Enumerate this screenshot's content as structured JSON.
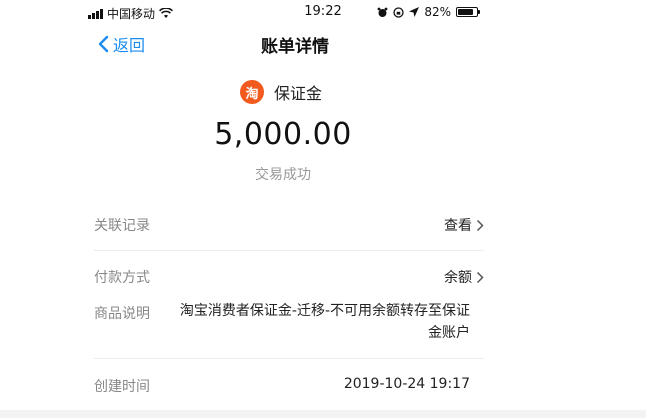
{
  "status_bar": {
    "carrier": "中国移动",
    "time": "19:22",
    "battery_percent": "82%",
    "battery_level": 0.82
  },
  "nav": {
    "back_label": "返回",
    "title": "账单详情"
  },
  "merchant": {
    "logo_char": "淘",
    "name": "保证金",
    "brand_color": "#f25a1e"
  },
  "transaction": {
    "amount": "5,000.00",
    "status": "交易成功"
  },
  "details": {
    "related": {
      "label": "关联记录",
      "value": "查看"
    },
    "payment": {
      "label": "付款方式",
      "value": "余额"
    },
    "description": {
      "label": "商品说明",
      "line1": "淘宝消费者保证金-迁移-不可用余额转存至保证",
      "line2": "金账户"
    },
    "created": {
      "label": "创建时间",
      "value": "2019-10-24 19:17"
    }
  },
  "colors": {
    "accent": "#1a8cf0",
    "muted": "#888888"
  }
}
